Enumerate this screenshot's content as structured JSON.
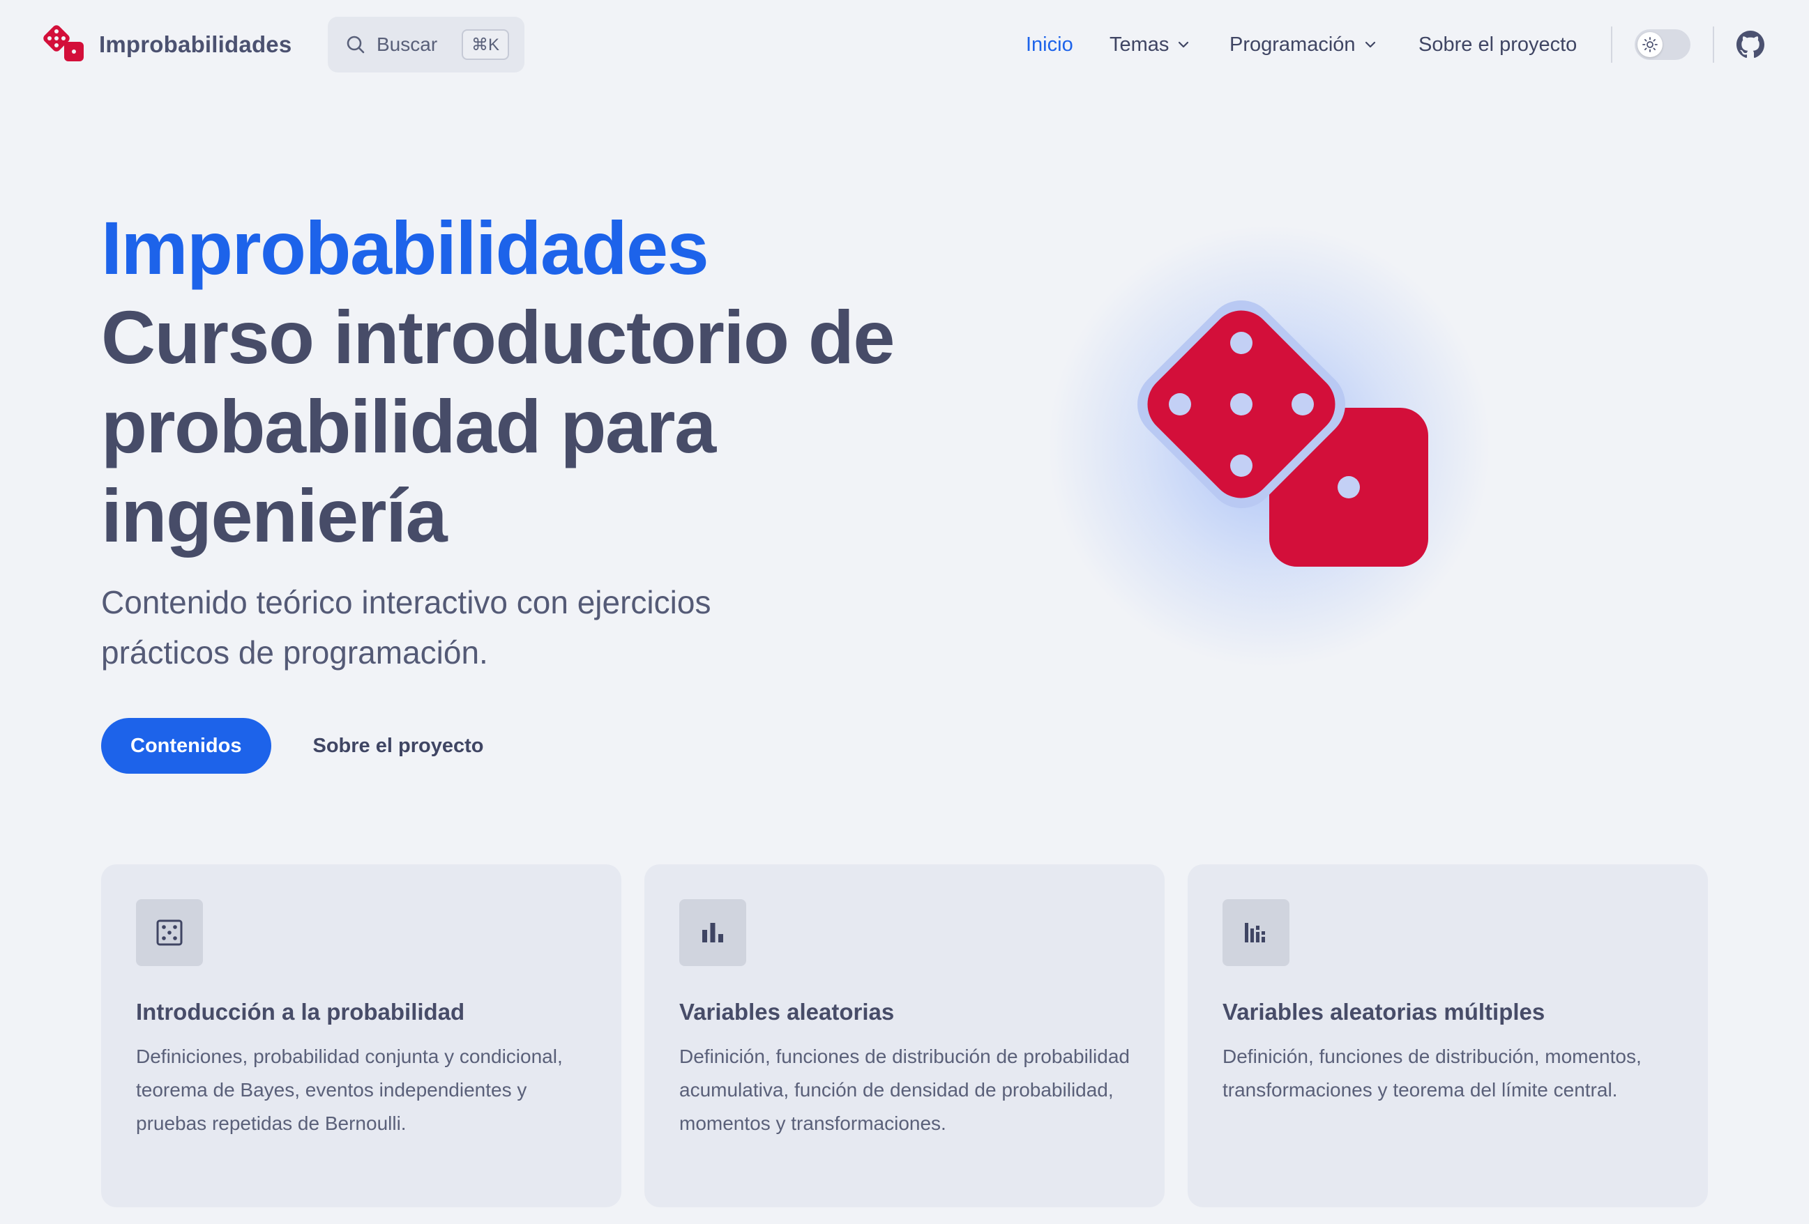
{
  "header": {
    "brand_name": "Improbabilidades",
    "search": {
      "label": "Buscar",
      "shortcut": "⌘K"
    },
    "nav": [
      {
        "label": "Inicio",
        "active": true,
        "has_dropdown": false
      },
      {
        "label": "Temas",
        "active": false,
        "has_dropdown": true
      },
      {
        "label": "Programación",
        "active": false,
        "has_dropdown": true
      },
      {
        "label": "Sobre el proyecto",
        "active": false,
        "has_dropdown": false
      }
    ],
    "theme_toggle": {
      "state": "light",
      "icon": "sun-icon"
    },
    "github_icon": "github-icon"
  },
  "hero": {
    "title_accent": "Improbabilidades",
    "title": "Curso introductorio de probabilidad para ingeniería",
    "tagline": "Contenido teórico interactivo con ejercicios prácticos de programación.",
    "primary_action": "Contenidos",
    "secondary_action": "Sobre el proyecto",
    "image_icon": "dice-icon"
  },
  "features": [
    {
      "icon": "die-icon",
      "title": "Introducción a la probabilidad",
      "description": "Definiciones, probabilidad conjunta y condicional, teorema de Bayes, eventos independientes y pruebas repetidas de Bernoulli."
    },
    {
      "icon": "bar-chart-icon",
      "title": "Variables aleatorias",
      "description": "Definición, funciones de distribución de probabilidad acumulativa, función de densidad de probabilidad, momentos y transformaciones."
    },
    {
      "icon": "grouped-bar-chart-icon",
      "title": "Variables aleatorias múltiples",
      "description": "Definición, funciones de distribución, momentos, transformaciones y teorema del límite central."
    }
  ],
  "colors": {
    "accent": "#1d63ea",
    "dice": "#d30f3a",
    "background": "#f1f3f7",
    "card": "#e6e9f1",
    "text": "#474c68"
  }
}
